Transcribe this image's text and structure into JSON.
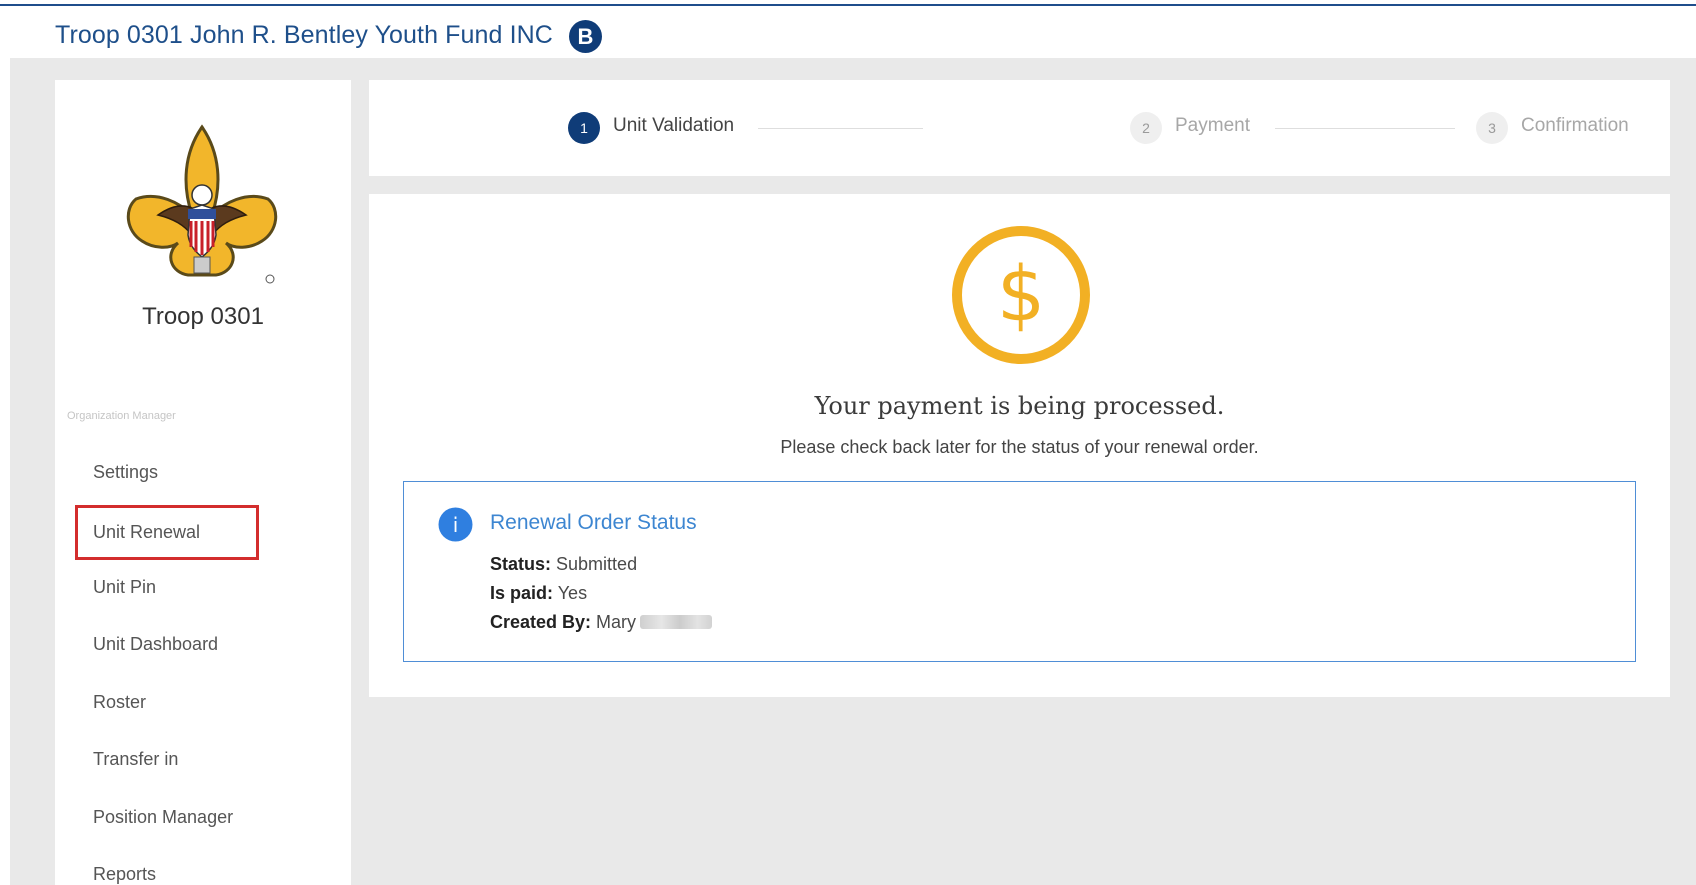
{
  "header": {
    "org_title": "Troop 0301 John R. Bentley Youth Fund INC",
    "badge": "B"
  },
  "sidebar": {
    "troop_name": "Troop 0301",
    "section_label": "Organization Manager",
    "items": [
      {
        "label": "Settings"
      },
      {
        "label": "Unit Renewal",
        "highlighted": true
      },
      {
        "label": "Unit Pin"
      },
      {
        "label": "Unit Dashboard"
      },
      {
        "label": "Roster"
      },
      {
        "label": "Transfer in"
      },
      {
        "label": "Position Manager"
      },
      {
        "label": "Reports"
      }
    ]
  },
  "stepper": {
    "steps": [
      {
        "number": "1",
        "label": "Unit Validation",
        "state": "active"
      },
      {
        "number": "2",
        "label": "Payment",
        "state": "inactive"
      },
      {
        "number": "3",
        "label": "Confirmation",
        "state": "inactive"
      }
    ]
  },
  "main": {
    "icon": "dollar-icon",
    "dollar_symbol": "$",
    "title": "Your payment is being processed.",
    "subtitle": "Please check back later for the status of your renewal order.",
    "status_box": {
      "icon": "info-icon",
      "info_symbol": "i",
      "title": "Renewal Order Status",
      "status_label": "Status:",
      "status_value": "Submitted",
      "paid_label": "Is paid:",
      "paid_value": "Yes",
      "created_label": "Created By:",
      "created_value": "Mary"
    }
  },
  "colors": {
    "brand_blue": "#1e4f8a",
    "navy": "#0f3c78",
    "accent_gold": "#f2b024",
    "info_blue": "#3d86d1",
    "highlight_red": "#d32d2d"
  }
}
